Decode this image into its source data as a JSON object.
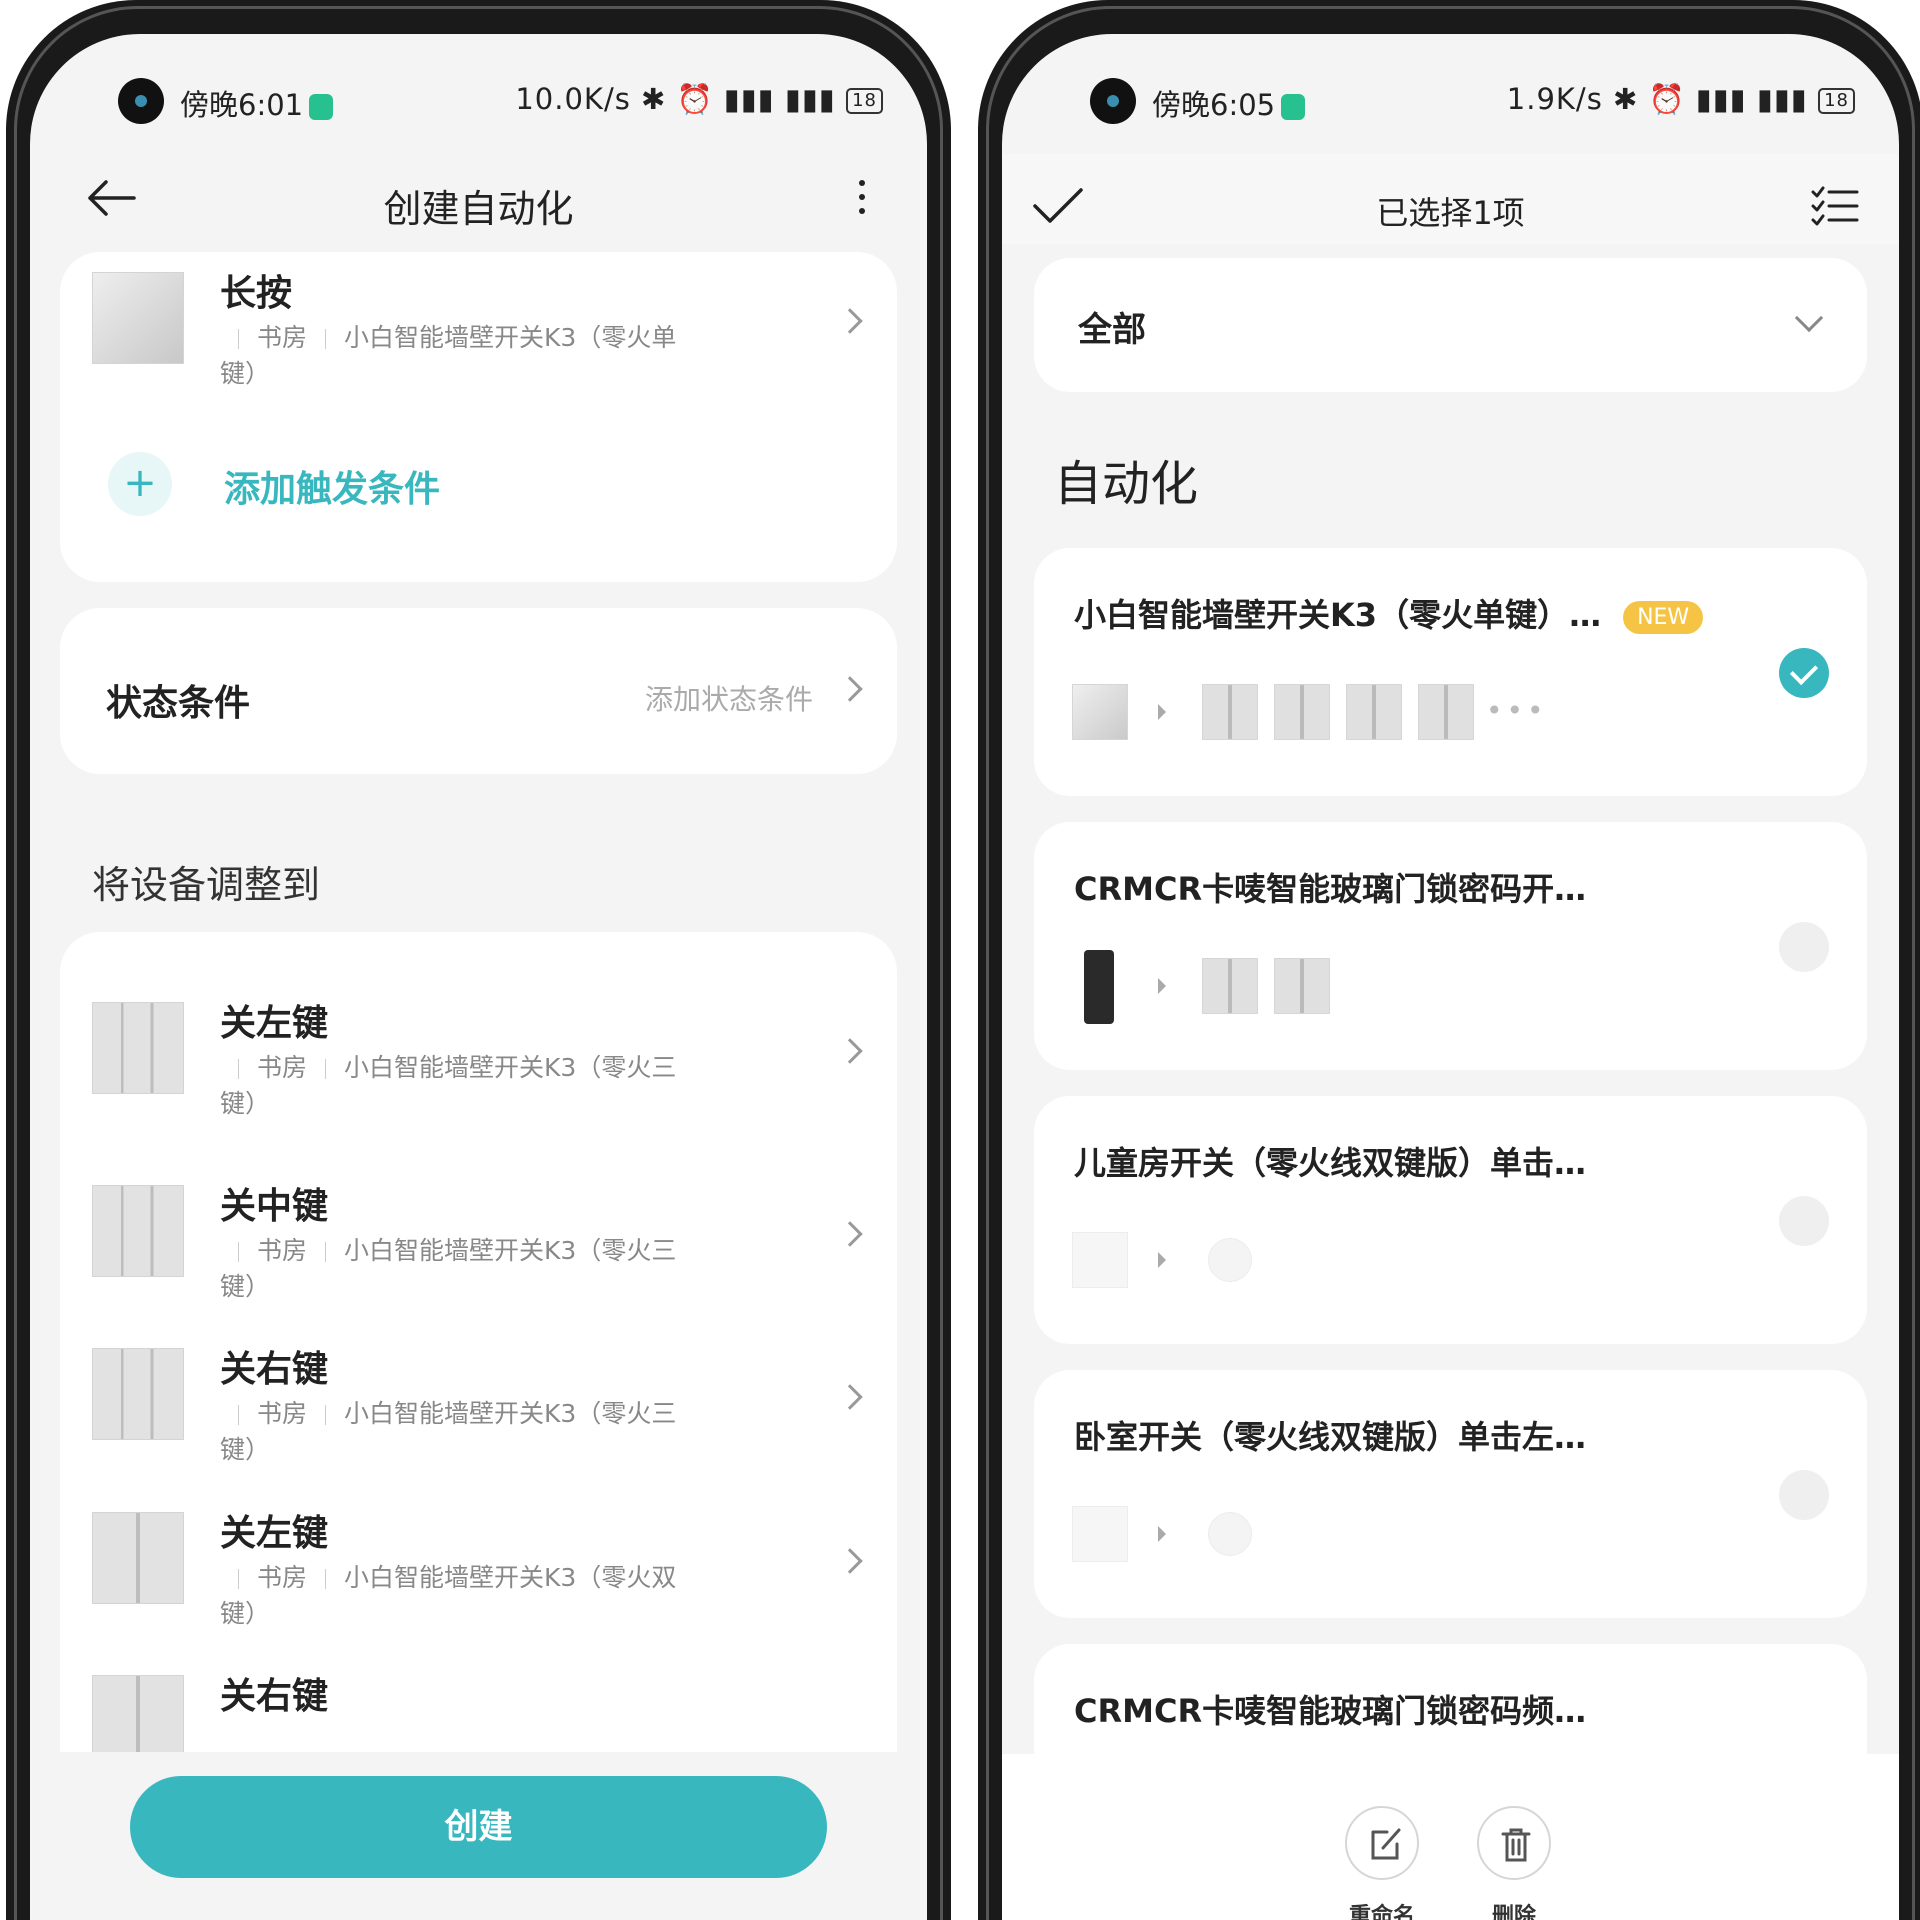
{
  "left": {
    "status": {
      "time": "傍晚6:01",
      "net": "10.0K/s",
      "battery": "18"
    },
    "title": "创建自动化",
    "trigger": {
      "name": "长按",
      "room": "书房",
      "device_line1": "小白智能墙壁开关K3（零火单",
      "device_line2": "键）"
    },
    "add_trigger_label": "添加触发条件",
    "state": {
      "title": "状态条件",
      "hint": "添加状态条件"
    },
    "section_title": "将设备调整到",
    "actions": [
      {
        "name": "关左键",
        "room": "书房",
        "device_line1": "小白智能墙壁开关K3（零火三",
        "device_line2": "键）"
      },
      {
        "name": "关中键",
        "room": "书房",
        "device_line1": "小白智能墙壁开关K3（零火三",
        "device_line2": "键）"
      },
      {
        "name": "关右键",
        "room": "书房",
        "device_line1": "小白智能墙壁开关K3（零火三",
        "device_line2": "键）"
      },
      {
        "name": "关左键",
        "room": "书房",
        "device_line1": "小白智能墙壁开关K3（零火双",
        "device_line2": "键）"
      },
      {
        "name": "关右键"
      }
    ],
    "create_label": "创建"
  },
  "right": {
    "status": {
      "time": "傍晚6:05",
      "net": "1.9K/s",
      "battery": "18"
    },
    "title": "已选择1项",
    "filter_label": "全部",
    "section_title": "自动化",
    "new_badge": "NEW",
    "automations": [
      {
        "name": "小白智能墙壁开关K3（零火单键）…",
        "checked": true
      },
      {
        "name": "CRMCR卡唛智能玻璃门锁密码开…",
        "checked": false
      },
      {
        "name": "儿童房开关（零火线双键版）单击…",
        "checked": false
      },
      {
        "name": "卧室开关（零火线双键版）单击左…",
        "checked": false
      },
      {
        "name": "CRMCR卡唛智能玻璃门锁密码频…",
        "checked": false
      }
    ],
    "rename_label": "重命名",
    "delete_label": "删除"
  }
}
